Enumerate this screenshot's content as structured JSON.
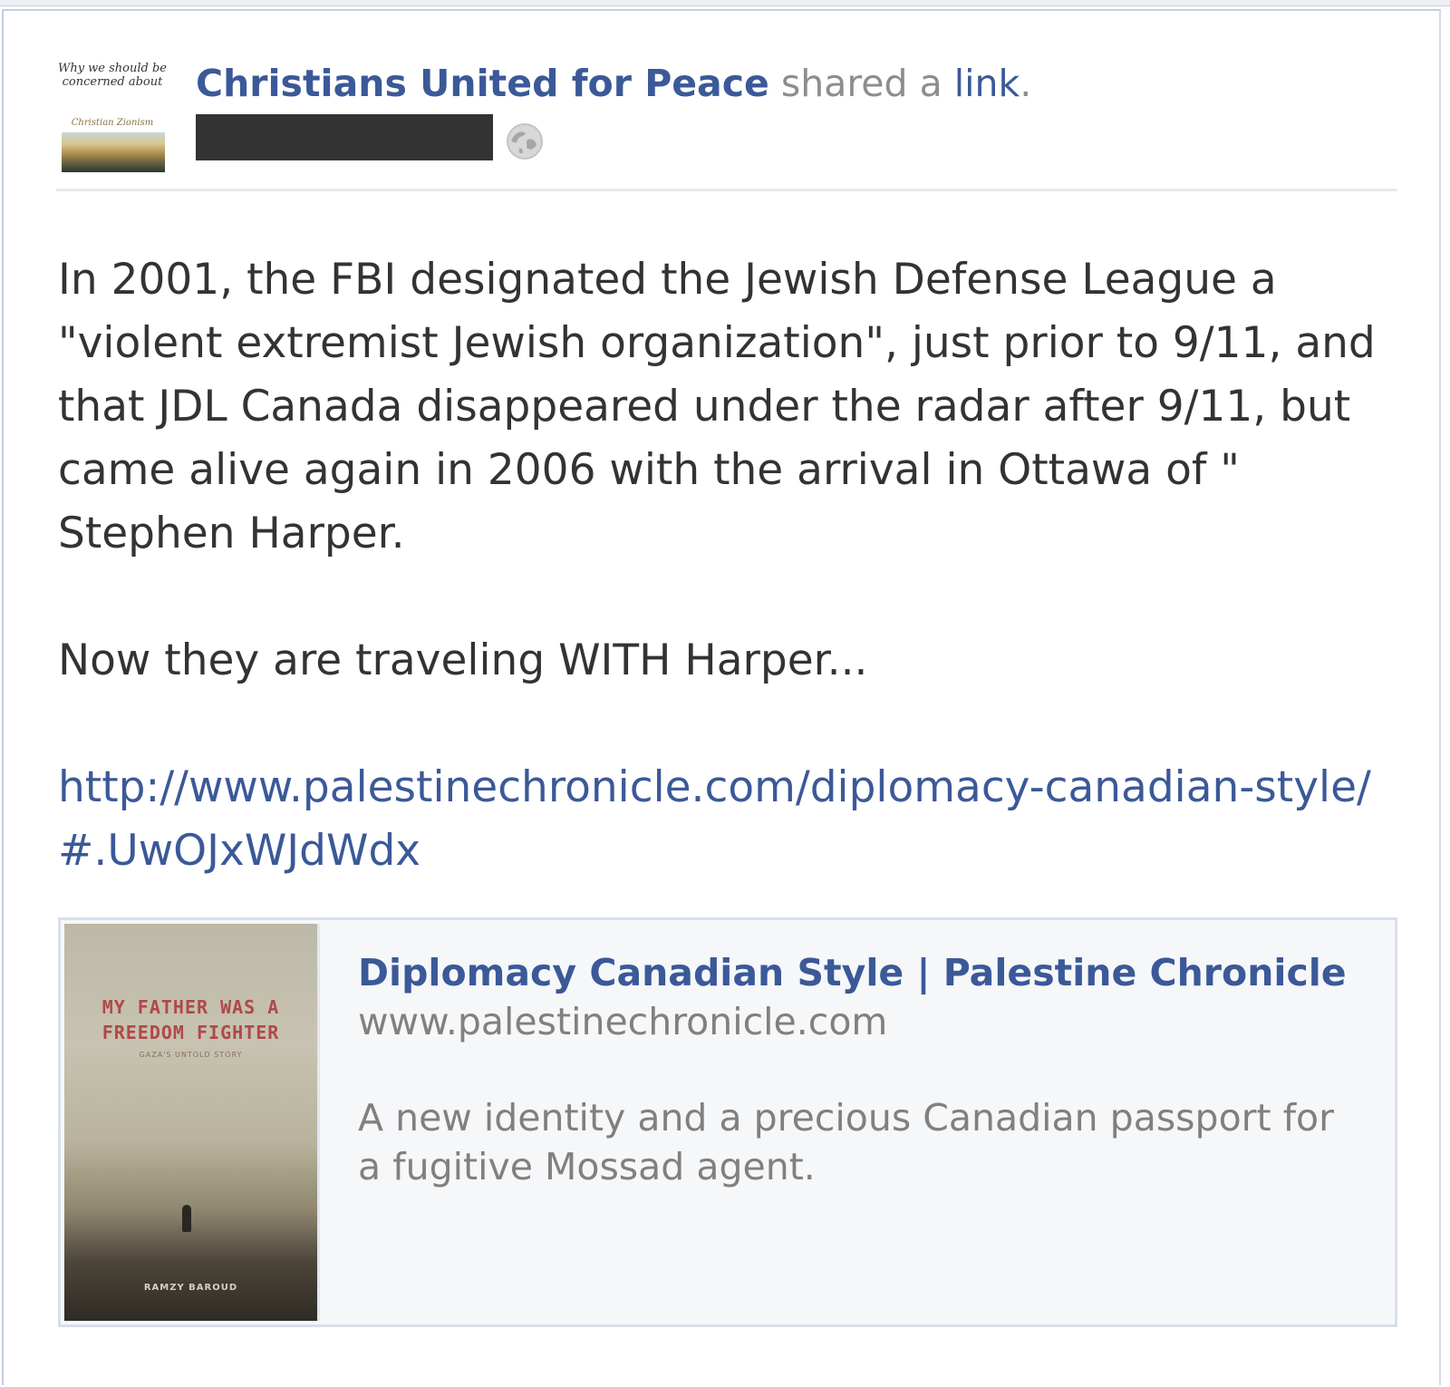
{
  "post": {
    "author": "Christians United for Peace",
    "action_text": " shared a ",
    "action_link": "link",
    "action_end": ".",
    "avatar": {
      "text": "Why we should be concerned about",
      "subtext": "Christian Zionism"
    },
    "privacy_icon": "globe-icon",
    "message": {
      "paragraph_1": "In 2001, the FBI designated the Jewish Defense League a \"violent extremist Jewish organization\", just prior to 9/11, and that JDL Canada disappeared under the radar after 9/11, but came alive again in 2006 with the arrival in Ottawa of \" Stephen Harper.",
      "paragraph_2": "Now they are traveling WITH Harper...",
      "url": "http://www.palestinechronicle.com/diplomacy-canadian-style/#.UwOJxWJdWdx"
    },
    "preview": {
      "title": "Diplomacy Canadian Style | Palestine Chronicle",
      "domain": "www.palestinechronicle.com",
      "description": "A new identity and a precious Canadian passport for a fugitive Mossad agent.",
      "thumbnail": {
        "book_title": "MY FATHER WAS A FREEDOM FIGHTER",
        "book_subtitle": "GAZA'S UNTOLD STORY",
        "book_author": "RAMZY BAROUD"
      }
    }
  },
  "colors": {
    "link_blue": "#3b5998",
    "body_text": "#333333",
    "muted_text": "#808080",
    "preview_bg": "#f6f7f9",
    "redaction": "#333333"
  }
}
